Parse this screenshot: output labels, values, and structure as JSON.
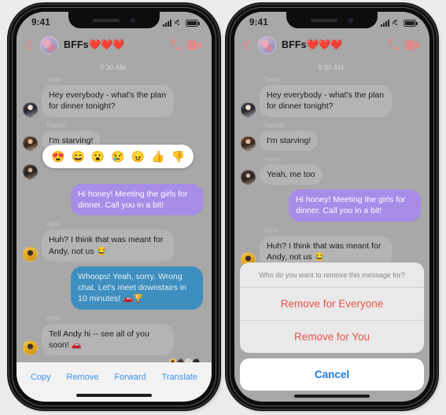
{
  "status_bar": {
    "time": "9:41",
    "signal_icon": "cellular-bars-icon",
    "wifi_icon": "wifi-icon",
    "battery_icon": "battery-icon"
  },
  "chat_header": {
    "back_icon": "back-chevron-icon",
    "avatar": "group-avatar",
    "title": "BFFs",
    "hearts": "❤️❤️❤️",
    "call_icon": "phone-icon",
    "video_icon": "video-camera-icon"
  },
  "conversation": {
    "daystamp": "9:30 AM",
    "left_messages": [
      {
        "sender": "Tanvi",
        "text": "Hey everybody - what's the plan for dinner tonight?",
        "side": "in",
        "avatar": "av-tanvi"
      },
      {
        "sender": "Rachel",
        "text": "I'm starving!",
        "side": "in",
        "avatar": "av-rachel"
      },
      {
        "sender": "Hailey",
        "text": "",
        "side": "in",
        "avatar": "av-hailey"
      },
      {
        "sender": "",
        "text": "Hi honey! Meeting the girls for dinner. Call you in a bit!",
        "side": "out-purple",
        "avatar": ""
      },
      {
        "sender": "Alice",
        "text": "Huh? I think that was meant for Andy, not us 😂",
        "side": "in",
        "avatar": "av-alice"
      },
      {
        "sender": "",
        "text": "Whoops! Yeah, sorry. Wrong chat. Let's meet downstairs in 10 minutes! 🚗🏆",
        "side": "out-blue",
        "avatar": ""
      },
      {
        "sender": "Alice",
        "text": "Tell Andy hi -- see all of you soon! 🚗",
        "side": "in",
        "avatar": "av-alice"
      }
    ],
    "right_messages": [
      {
        "sender": "Tanvi",
        "text": "Hey everybody - what's the plan for dinner tonight?",
        "side": "in",
        "avatar": "av-tanvi"
      },
      {
        "sender": "Rachel",
        "text": "I'm starving!",
        "side": "in",
        "avatar": "av-rachel"
      },
      {
        "sender": "Hailey",
        "text": "Yeah, me too",
        "side": "in",
        "avatar": "av-hailey"
      },
      {
        "sender": "",
        "text": "Hi honey! Meeting the girls for dinner. Call you in a bit!",
        "side": "out-purple",
        "avatar": ""
      },
      {
        "sender": "Alice",
        "text": "Huh? I think that was meant for Andy, not us 😂",
        "side": "in",
        "avatar": "av-alice"
      },
      {
        "sender": "",
        "text": "Whoops! Yeah, sorry. Wrong",
        "side": "out-blue",
        "avatar": ""
      }
    ]
  },
  "reaction_picker": {
    "emojis": [
      "😍",
      "😄",
      "😮",
      "😢",
      "😠",
      "👍",
      "👎"
    ],
    "names": [
      "heart-eyes-reaction",
      "laughing-reaction",
      "surprised-reaction",
      "sad-reaction",
      "angry-reaction",
      "thumbs-up-reaction",
      "thumbs-down-reaction"
    ]
  },
  "message_reactions": {
    "count": 4
  },
  "action_bar": {
    "copy": "Copy",
    "remove": "Remove",
    "forward": "Forward",
    "translate": "Translate"
  },
  "action_sheet": {
    "title": "Who do you want to remove this message for?",
    "remove_everyone": "Remove for Everyone",
    "remove_you": "Remove for You",
    "cancel": "Cancel"
  },
  "colors": {
    "screen_bg": "#a8a8a8",
    "incoming_bubble": "#b4b4b4",
    "purple_bubble": "#a78ce8",
    "blue_bubble": "#3e8fc0",
    "action_link": "#3e93e8",
    "destructive": "#e5544a",
    "cancel_blue": "#1e7ce0",
    "header_tint": "#e08b8b"
  }
}
